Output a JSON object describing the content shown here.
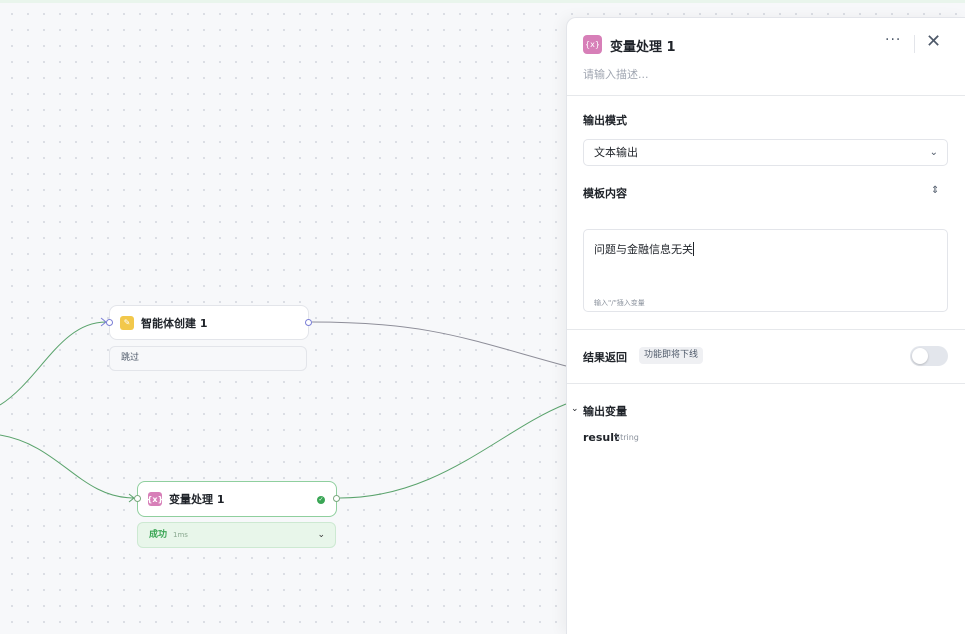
{
  "canvas": {
    "agent_node": {
      "title": "智能体创建 1",
      "status": "跳过"
    },
    "var_node": {
      "title": "变量处理 1",
      "status": "成功",
      "duration": "1ms"
    }
  },
  "panel": {
    "icon_text": "{x}",
    "title": "变量处理 1",
    "description_placeholder": "请输入描述...",
    "output_mode": {
      "label": "输出模式",
      "value": "文本输出"
    },
    "template": {
      "label": "模板内容",
      "value": "问题与金融信息无关",
      "hint": "输入\"/\"插入变量"
    },
    "result_return": {
      "label": "结果返回",
      "badge": "功能即将下线"
    },
    "output_vars": {
      "label": "输出变量",
      "items": [
        {
          "name": "result",
          "type": "String"
        }
      ]
    }
  }
}
